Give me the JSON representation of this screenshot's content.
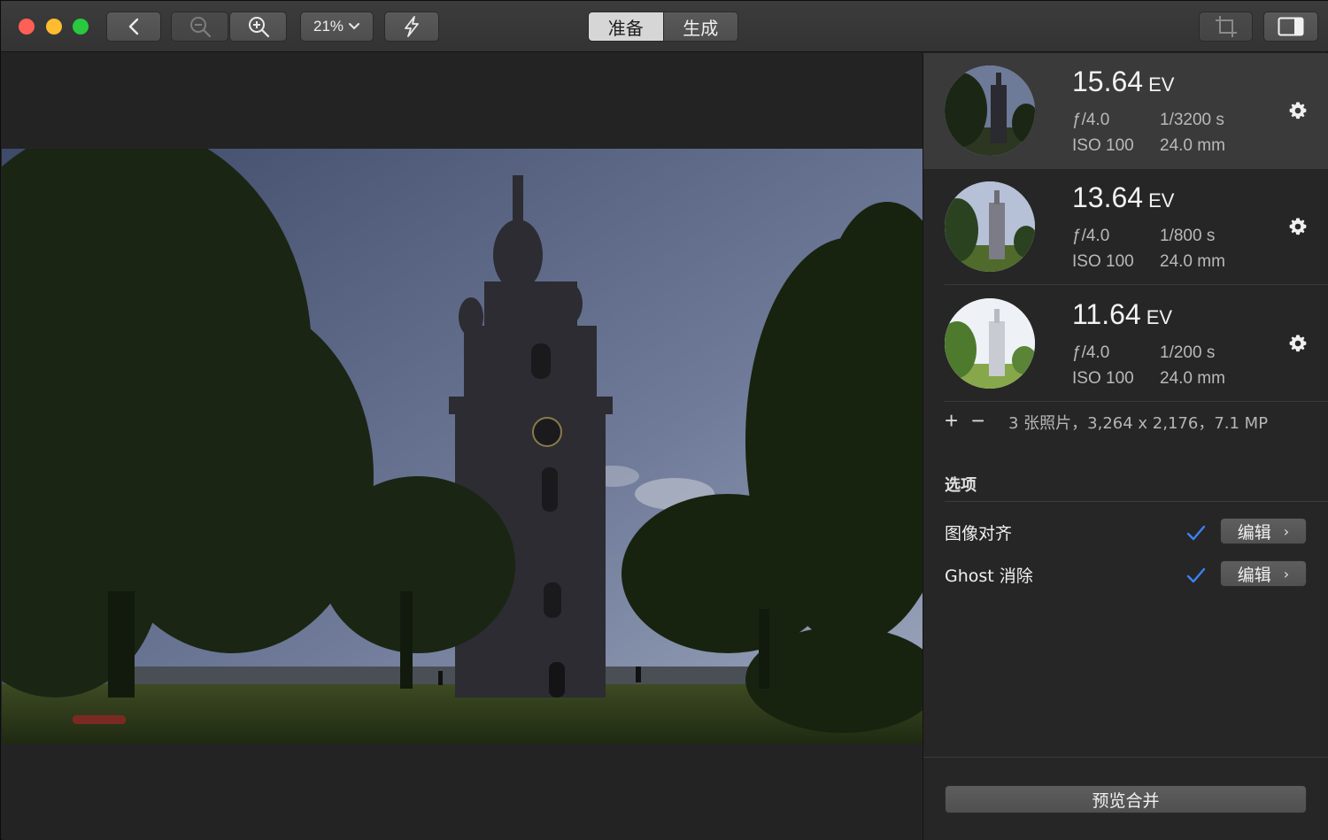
{
  "toolbar": {
    "zoom_level": "21%",
    "segments": [
      {
        "label": "准备",
        "active": true
      },
      {
        "label": "生成",
        "active": false
      }
    ]
  },
  "photos": [
    {
      "ev": "15.64",
      "ev_unit": "EV",
      "aperture": "ƒ/4.0",
      "shutter": "1/3200 s",
      "iso": "ISO 100",
      "focal": "24.0 mm",
      "selected": true
    },
    {
      "ev": "13.64",
      "ev_unit": "EV",
      "aperture": "ƒ/4.0",
      "shutter": "1/800 s",
      "iso": "ISO 100",
      "focal": "24.0 mm",
      "selected": false
    },
    {
      "ev": "11.64",
      "ev_unit": "EV",
      "aperture": "ƒ/4.0",
      "shutter": "1/200 s",
      "iso": "ISO 100",
      "focal": "24.0 mm",
      "selected": false
    }
  ],
  "info": {
    "add_symbol": "+",
    "remove_symbol": "−",
    "summary": "3 张照片，3,264 x 2,176，7.1 MP"
  },
  "options": {
    "title": "选项",
    "items": [
      {
        "label": "图像对齐",
        "checked": true,
        "edit_label": "编辑",
        "chevron": "›"
      },
      {
        "label": "Ghost 消除",
        "checked": true,
        "edit_label": "编辑",
        "chevron": "›"
      }
    ]
  },
  "preview_button": "预览合并",
  "colors": {
    "accent_check": "#3b82f6",
    "close": "#fe5f57",
    "minimize": "#febc2e",
    "maximize": "#28c840"
  },
  "icons": [
    "back-arrow-icon",
    "zoom-out-icon",
    "zoom-in-icon",
    "chevron-down-icon",
    "lightning-icon",
    "crop-icon",
    "sidebar-toggle-icon",
    "gear-icon",
    "checkmark-icon"
  ]
}
